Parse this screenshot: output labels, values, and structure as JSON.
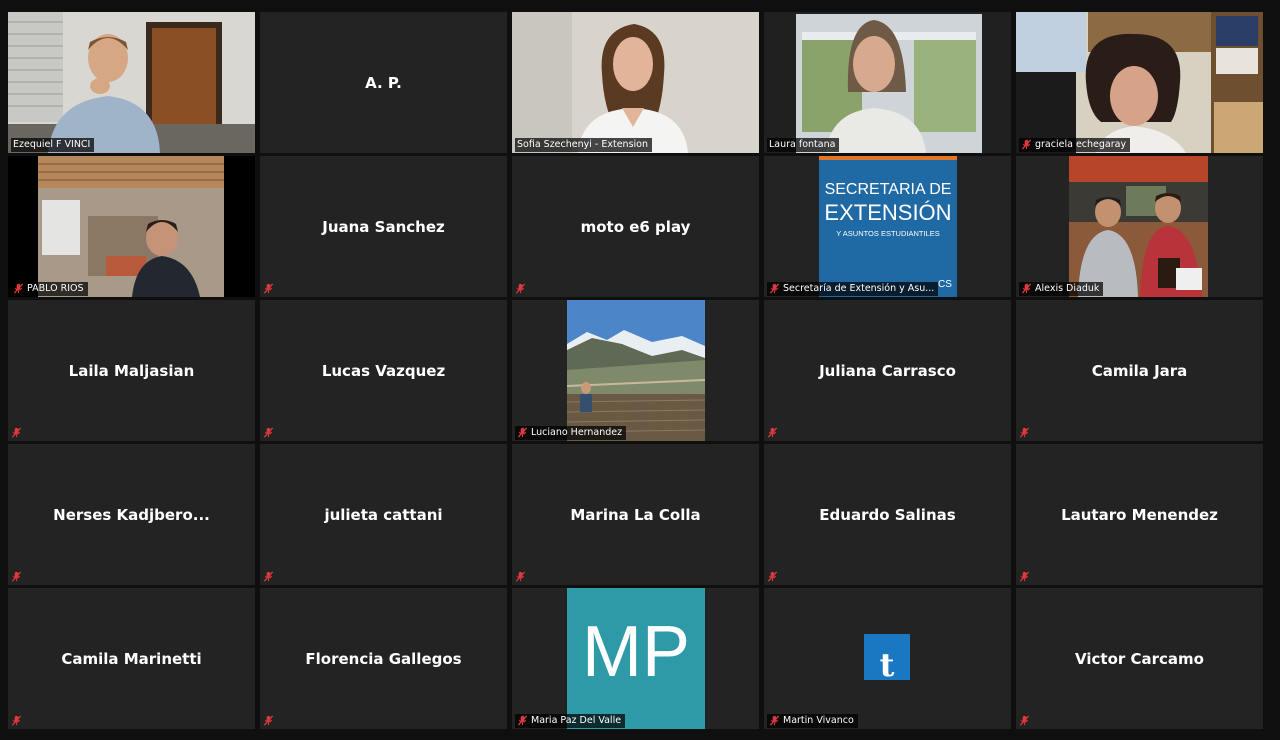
{
  "participants": [
    {
      "name": "Ezequiel F VINCI"
    },
    {
      "name": "A. P."
    },
    {
      "name": "Sofia Szechenyi - Extension"
    },
    {
      "name": "Laura fontana"
    },
    {
      "name": "graciela echegaray"
    },
    {
      "name": "PABLO RIOS"
    },
    {
      "name": "Juana Sanchez"
    },
    {
      "name": "moto e6 play"
    },
    {
      "name": "Secretaría de Extensión y Asu...",
      "logo_line1": "SECRETARIA DE",
      "logo_line2": "EXTENSIÓN",
      "logo_line3": "Y ASUNTOS ESTUDIANTILES",
      "logo_corner": "CS"
    },
    {
      "name": "Alexis Diaduk"
    },
    {
      "name": "Laila Maljasian"
    },
    {
      "name": "Lucas Vazquez"
    },
    {
      "name": "Luciano Hernandez"
    },
    {
      "name": "Juliana Carrasco"
    },
    {
      "name": "Camila Jara"
    },
    {
      "name": "Nerses  Kadjbero..."
    },
    {
      "name": "julieta cattani"
    },
    {
      "name": "Marina La Colla"
    },
    {
      "name": "Eduardo Salinas"
    },
    {
      "name": "Lautaro Menendez"
    },
    {
      "name": "Camila Marinetti"
    },
    {
      "name": "Florencia Gallegos"
    },
    {
      "name": "Maria Paz Del Valle",
      "avatar_text": "MP"
    },
    {
      "name": "Martin Vivanco",
      "avatar_text": "t"
    },
    {
      "name": "Victor Carcamo"
    }
  ],
  "active_speaker": "Laura fontana",
  "colors": {
    "tile_bg": "#232323",
    "active_border": "#c7e23f",
    "mute_red": "#e0383e",
    "mp_teal": "#2e9aa8",
    "secretaria_blue": "#1f6aa5",
    "t_blue": "#1a78c2"
  },
  "icons": {
    "muted": "microphone-muted-icon"
  }
}
